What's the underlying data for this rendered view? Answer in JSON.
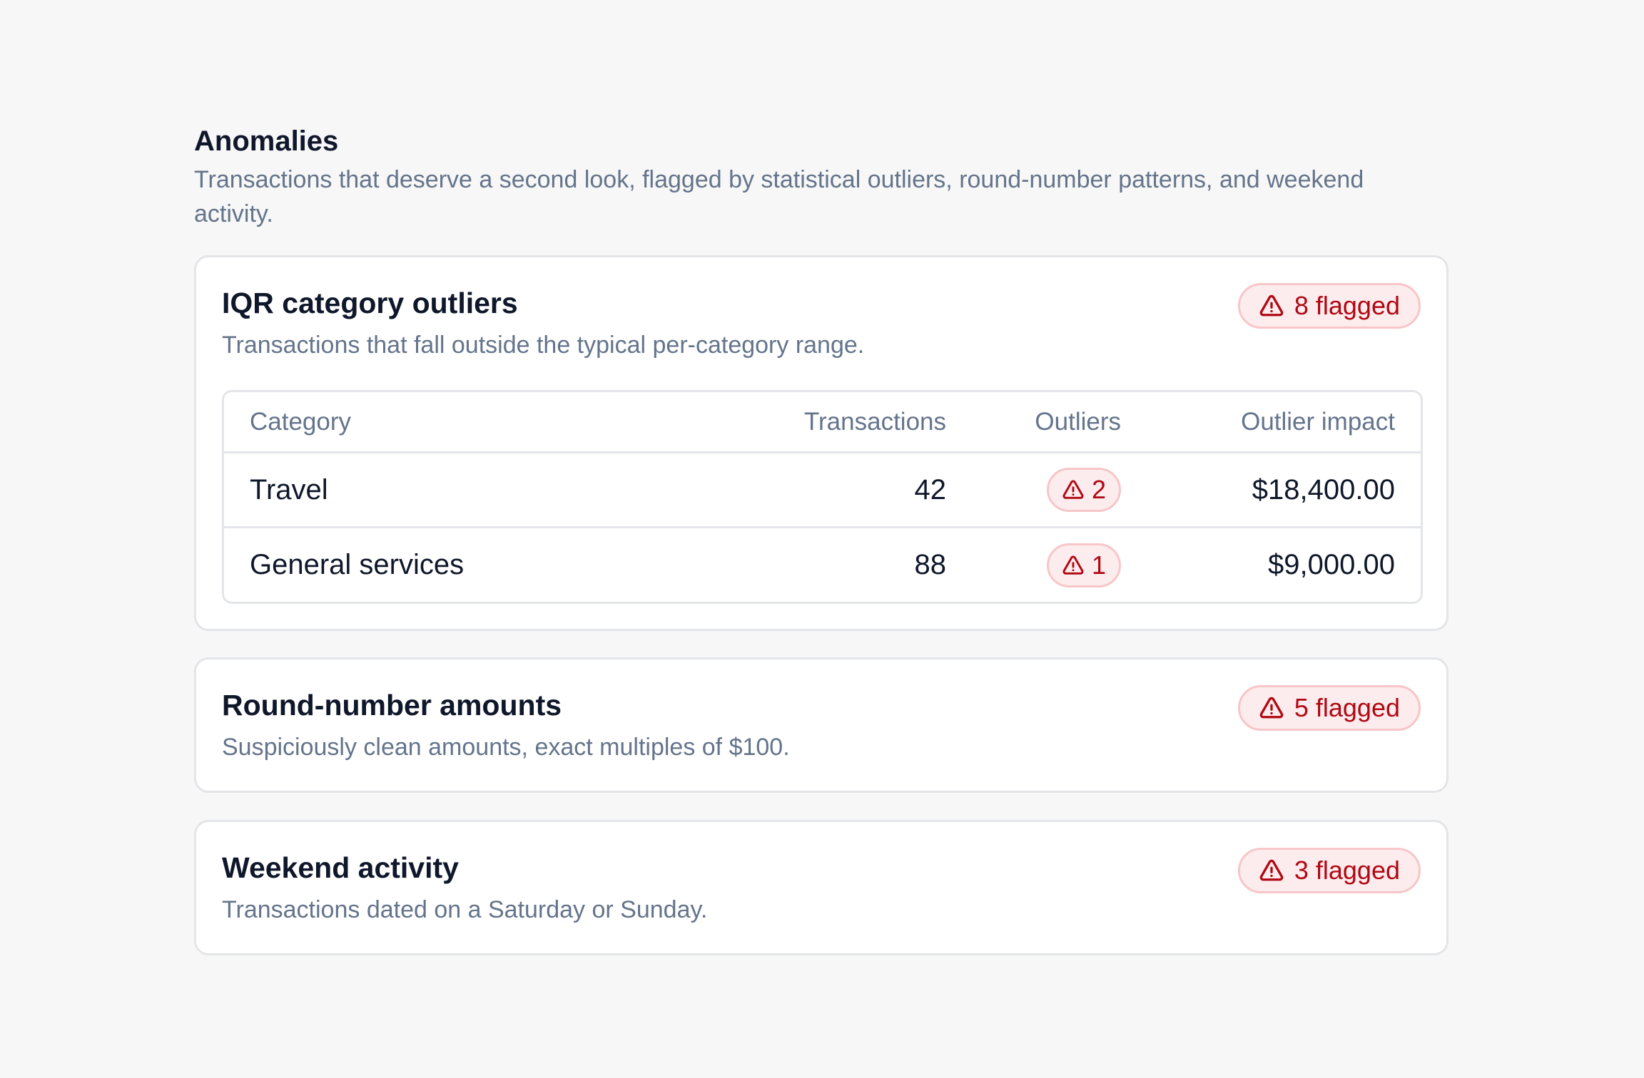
{
  "section": {
    "title": "Anomalies",
    "description": "Transactions that deserve a second look, flagged by statistical outliers, round-number patterns, and weekend activity."
  },
  "cards": [
    {
      "title": "IQR category outliers",
      "description": "Transactions that fall outside the typical per-category range.",
      "badge": "8 flagged",
      "icon": "warning-triangle-icon"
    },
    {
      "title": "Round-number amounts",
      "description": "Suspiciously clean amounts, exact multiples of $100.",
      "badge": "5 flagged",
      "icon": "warning-triangle-icon"
    },
    {
      "title": "Weekend activity",
      "description": "Transactions dated on a Saturday or Sunday.",
      "badge": "3 flagged",
      "icon": "warning-triangle-icon"
    }
  ],
  "table": {
    "headers": {
      "category": "Category",
      "transactions": "Transactions",
      "outliers": "Outliers",
      "impact": "Outlier impact"
    },
    "rows": [
      {
        "category": "Travel",
        "transactions": "42",
        "outliers": "2",
        "impact": "$18,400.00"
      },
      {
        "category": "General services",
        "transactions": "88",
        "outliers": "1",
        "impact": "$9,000.00"
      }
    ]
  },
  "colors": {
    "background": "#f7f7f7",
    "card": "#ffffff",
    "border": "#e3e5e8",
    "muted_text": "#64748b",
    "danger_text": "#b00814",
    "danger_bg": "#fdeced",
    "danger_border": "#f7c6c9"
  }
}
